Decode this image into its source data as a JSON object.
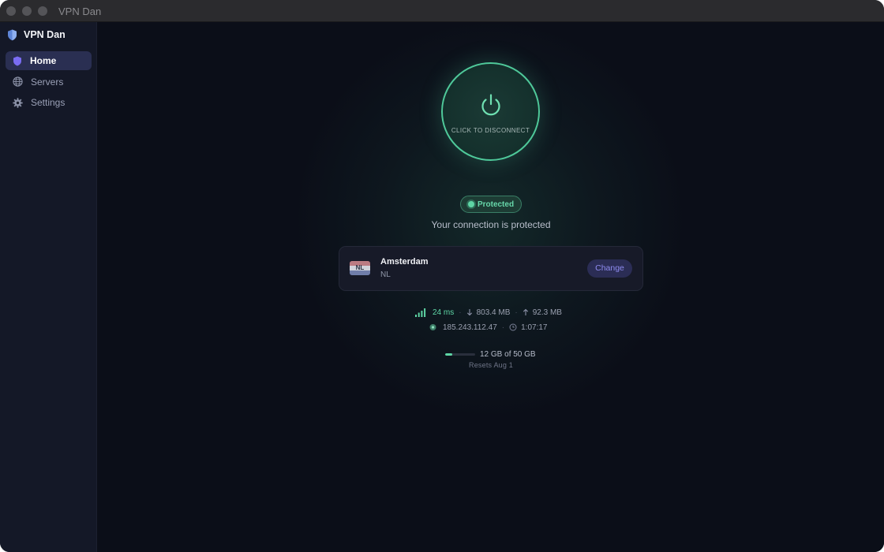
{
  "window": {
    "title": "VPN Dan"
  },
  "sidebar": {
    "brand": "VPN Dan",
    "items": [
      {
        "label": "Home",
        "icon": "shield-icon",
        "active": true
      },
      {
        "label": "Servers",
        "icon": "globe-icon",
        "active": false
      },
      {
        "label": "Settings",
        "icon": "gear-icon",
        "active": false
      }
    ]
  },
  "connection": {
    "button_label": "CLICK TO DISCONNECT",
    "status_badge": "Protected",
    "status_text": "Your connection is protected",
    "server": {
      "city": "Amsterdam",
      "country": "NL",
      "flag_code": "NL",
      "change_label": "Change"
    },
    "stats": {
      "latency": "24 ms",
      "download": "803.4 MB",
      "upload": "92.3 MB",
      "ip": "185.243.112.47",
      "duration": "1:07:17"
    },
    "quota": {
      "text": "12 GB of 50 GB",
      "used_fraction": 0.24,
      "resets": "Resets Aug 1"
    }
  },
  "colors": {
    "accent_green": "#5ed6a5",
    "accent_purple": "#8f8cf0",
    "background": "#0b0e18",
    "sidebar": "#141827"
  }
}
